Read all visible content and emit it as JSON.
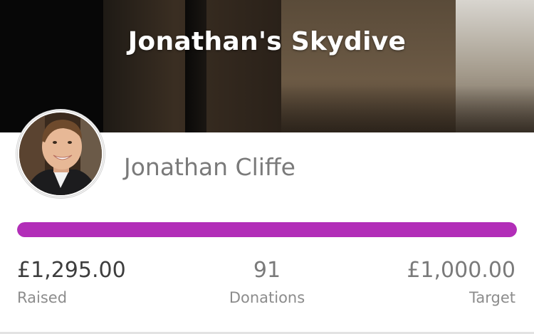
{
  "header": {
    "title": "Jonathan's Skydive"
  },
  "fundraiser": {
    "name": "Jonathan Cliffe",
    "avatar_icon": "profile-photo"
  },
  "progress": {
    "fraction": 1.0,
    "color": "#b22eb8"
  },
  "stats": {
    "raised": {
      "value": "£1,295.00",
      "label": "Raised"
    },
    "donations": {
      "value": "91",
      "label": "Donations"
    },
    "target": {
      "value": "£1,000.00",
      "label": "Target"
    }
  }
}
